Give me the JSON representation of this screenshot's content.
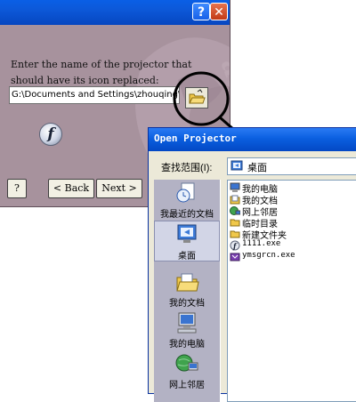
{
  "wizard": {
    "help_glyph": "?",
    "close_glyph": "✕",
    "prompt": "Enter the name of the projector that should have its icon replaced:",
    "path_value": "G:\\Documents and Settings\\zhouqing\\桌面\\",
    "flash_glyph": "f",
    "buttons": {
      "help": "?",
      "back": "< Back",
      "next": "Next >"
    }
  },
  "dialog": {
    "title": "Open Projector",
    "look_in_label": "查找范围(I):",
    "look_in_value": "桌面",
    "places": [
      {
        "label": "我最近的文档",
        "icon": "recent-docs-icon"
      },
      {
        "label": "桌面",
        "icon": "desktop-icon"
      },
      {
        "label": "我的文档",
        "icon": "my-documents-icon"
      },
      {
        "label": "我的电脑",
        "icon": "my-computer-icon"
      },
      {
        "label": "网上邻居",
        "icon": "network-places-icon"
      }
    ],
    "files": [
      {
        "name": "我的电脑",
        "icon": "computer-icon"
      },
      {
        "name": "我的文档",
        "icon": "documents-icon"
      },
      {
        "name": "网上邻居",
        "icon": "network-icon"
      },
      {
        "name": "临时目录",
        "icon": "folder-icon"
      },
      {
        "name": "新建文件夹",
        "icon": "folder-icon"
      },
      {
        "name": "1111.exe",
        "icon": "flash-projector-icon"
      },
      {
        "name": "ymsgrcn.exe",
        "icon": "exe-icon"
      }
    ]
  },
  "colors": {
    "titlebar_blue": "#0a5fe6",
    "wizard_bg": "#a7929d",
    "dialog_bg": "#ece9d8",
    "places_bg": "#b3b2c4"
  }
}
